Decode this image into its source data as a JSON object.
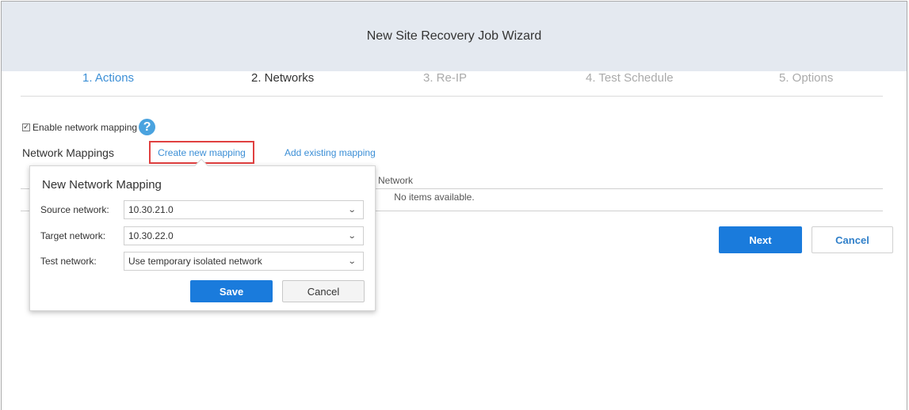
{
  "window": {
    "title": "New Site Recovery Job Wizard"
  },
  "steps": [
    {
      "label": "1. Actions",
      "state": "active"
    },
    {
      "label": "2. Networks",
      "state": "current"
    },
    {
      "label": "3. Re-IP",
      "state": "disabled"
    },
    {
      "label": "4. Test Schedule",
      "state": "disabled"
    },
    {
      "label": "5. Options",
      "state": "disabled"
    }
  ],
  "enable_mapping": {
    "checked": true,
    "checkmark": "✓",
    "label": "Enable network mapping",
    "help_icon": "question-circle-icon",
    "help_glyph": "?"
  },
  "mappings": {
    "label": "Network Mappings",
    "create_link": "Create new mapping",
    "add_link": "Add existing mapping",
    "column_target": "Network",
    "empty_text": "No items available."
  },
  "footer": {
    "next_label": "Next",
    "cancel_label": "Cancel"
  },
  "popup": {
    "title": "New Network Mapping",
    "source_label": "Source network:",
    "source_value": "10.30.21.0",
    "target_label": "Target network:",
    "target_value": "10.30.22.0",
    "test_label": "Test network:",
    "test_value": "Use temporary isolated network",
    "chevron_glyph": "⌄",
    "save_label": "Save",
    "cancel_label": "Cancel"
  },
  "colors": {
    "accent": "#1a7bdc",
    "link": "#3c8fd6",
    "highlight_border": "#e04040",
    "header_bg": "#e4e9f0"
  }
}
